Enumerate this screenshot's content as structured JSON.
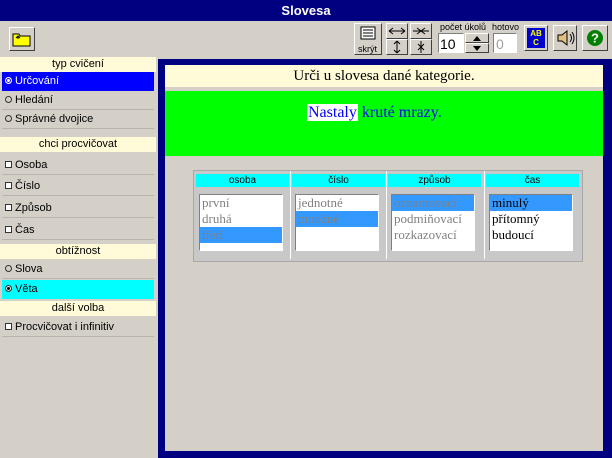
{
  "window": {
    "title": "Slovesa"
  },
  "toolbar": {
    "hide_label": "skrýt",
    "task_count_label": "počet úkolů",
    "task_count_value": "10",
    "done_label": "hotovo",
    "done_value": "0",
    "spell_letters": "ABC"
  },
  "sidebar": {
    "exercise_type": {
      "header": "typ cvičení",
      "options": [
        "Určování",
        "Hledání",
        "Správné dvojice"
      ]
    },
    "practice": {
      "header": "chci procvičovat",
      "options": [
        "Osoba",
        "Číslo",
        "Způsob",
        "Čas"
      ]
    },
    "difficulty": {
      "header": "obtížnost",
      "options": [
        "Slova",
        "Věta"
      ]
    },
    "other": {
      "header": "další volba",
      "options": [
        "Procvičovat i infinitiv"
      ]
    }
  },
  "main": {
    "instruction": "Urči u slovesa dané kategorie.",
    "sentence_verb": "Nastaly",
    "sentence_rest": " kruté mrazy.",
    "columns": [
      {
        "header": "osoba",
        "items": [
          "první",
          "druhá",
          "třetí"
        ],
        "selected": 2
      },
      {
        "header": "číslo",
        "items": [
          "jednotné",
          "množné"
        ],
        "selected": 1
      },
      {
        "header": "způsob",
        "items": [
          "oznamovací",
          "podmiňovací",
          "rozkazovací"
        ],
        "selected": 0
      },
      {
        "header": "čas",
        "items": [
          "minulý",
          "přítomný",
          "budoucí"
        ],
        "selected": 0
      }
    ]
  },
  "colors": {
    "title_bar": "#000080",
    "selection_blue": "#0000ff",
    "selection_cyan": "#00ffff",
    "sentence_bg": "#00ff00",
    "header_bg": "#fffbd8",
    "list_selection": "#3399ff"
  }
}
